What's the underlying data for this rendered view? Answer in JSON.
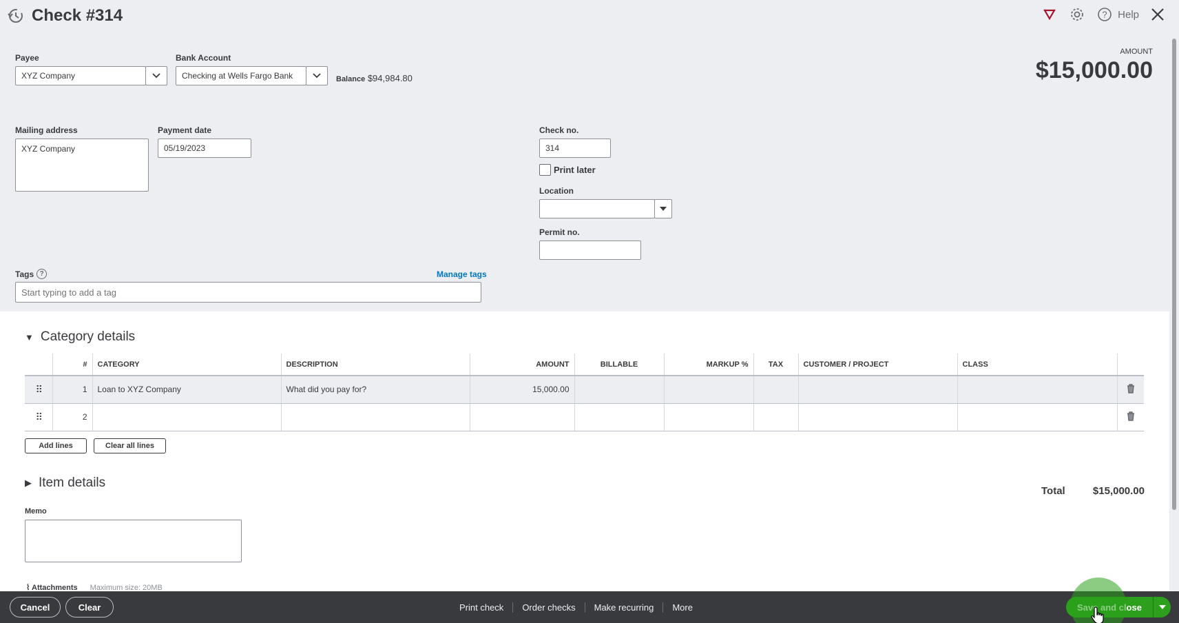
{
  "header": {
    "title": "Check #314",
    "help_label": "Help",
    "icons": [
      "history-icon",
      "alert-triangle-icon",
      "gear-icon",
      "help-icon",
      "close-icon"
    ]
  },
  "payee": {
    "label": "Payee",
    "value": "XYZ Company"
  },
  "bank_account": {
    "label": "Bank Account",
    "value": "Checking at Wells Fargo Bank"
  },
  "balance": {
    "label": "Balance",
    "value": "$94,984.80"
  },
  "amount": {
    "label": "AMOUNT",
    "value": "$15,000.00"
  },
  "mailing_address": {
    "label": "Mailing address",
    "value": "XYZ Company"
  },
  "payment_date": {
    "label": "Payment date",
    "value": "05/19/2023"
  },
  "check_no": {
    "label": "Check no.",
    "value": "314"
  },
  "print_later": {
    "label": "Print later",
    "checked": false
  },
  "location": {
    "label": "Location",
    "value": ""
  },
  "permit_no": {
    "label": "Permit no.",
    "value": ""
  },
  "tags": {
    "label": "Tags",
    "help": "?",
    "manage": "Manage tags",
    "placeholder": "Start typing to add a tag"
  },
  "category_details": {
    "title": "Category details",
    "columns": [
      "#",
      "CATEGORY",
      "DESCRIPTION",
      "AMOUNT",
      "BILLABLE",
      "MARKUP %",
      "TAX",
      "CUSTOMER / PROJECT",
      "CLASS"
    ],
    "rows": [
      {
        "num": "1",
        "category": "Loan to XYZ Company",
        "description_placeholder": "What did you pay for?",
        "amount": "15,000.00"
      },
      {
        "num": "2",
        "category": "",
        "description_placeholder": "",
        "amount": ""
      }
    ],
    "add_lines": "Add lines",
    "clear_all_lines": "Clear all lines"
  },
  "item_details": {
    "title": "Item details"
  },
  "total": {
    "label": "Total",
    "value": "$15,000.00"
  },
  "memo": {
    "label": "Memo",
    "value": ""
  },
  "attachments": {
    "label": "Attachments",
    "max": "Maximum size: 20MB"
  },
  "footer": {
    "cancel": "Cancel",
    "clear": "Clear",
    "print_check": "Print check",
    "order_checks": "Order checks",
    "make_recurring": "Make recurring",
    "more": "More",
    "save_close": "Save and close"
  },
  "colors": {
    "accent_green": "#2ca01c",
    "link_blue": "#0077c5",
    "footer_bg": "#393a3d",
    "form_bg": "#eceef1",
    "alert_red": "#a3152c"
  }
}
